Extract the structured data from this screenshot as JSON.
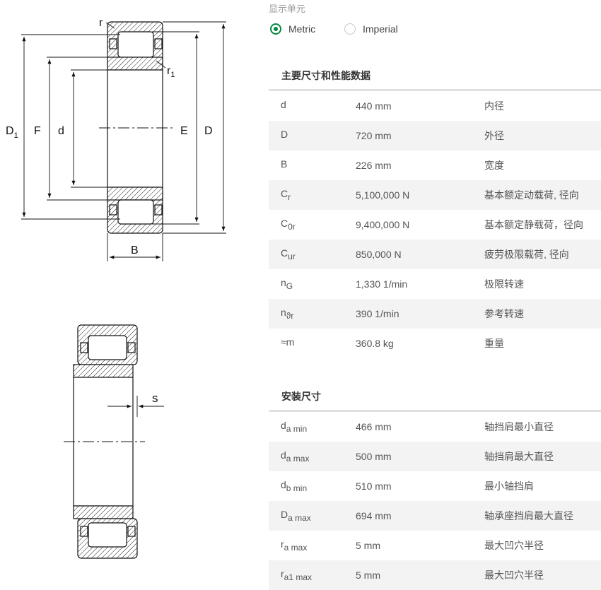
{
  "drawing_labels": {
    "r": "r",
    "r1_base": "r",
    "r1_sub": "1",
    "D1_base": "D",
    "D1_sub": "1",
    "F": "F",
    "d": "d",
    "E": "E",
    "D": "D",
    "B": "B",
    "s": "s"
  },
  "units": {
    "caption": "显示单元",
    "options": [
      {
        "label": "Metric",
        "selected": true
      },
      {
        "label": "Imperial",
        "selected": false
      }
    ]
  },
  "main_dimensions": {
    "title": "主要尺寸和性能数据",
    "rows": [
      {
        "sym": "d",
        "sub": "",
        "value": "440 mm",
        "desc": "内径"
      },
      {
        "sym": "D",
        "sub": "",
        "value": "720 mm",
        "desc": "外径"
      },
      {
        "sym": "B",
        "sub": "",
        "value": "226 mm",
        "desc": "宽度"
      },
      {
        "sym": "C",
        "sub": "r",
        "value": "5,100,000 N",
        "desc": "基本额定动载荷, 径向"
      },
      {
        "sym": "C",
        "sub": "0r",
        "value": "9,400,000 N",
        "desc": "基本额定静载荷，径向"
      },
      {
        "sym": "C",
        "sub": "ur",
        "value": "850,000 N",
        "desc": "疲劳极限载荷, 径向"
      },
      {
        "sym": "n",
        "sub": "G",
        "value": "1,330 1/min",
        "desc": "极限转速"
      },
      {
        "sym": "n",
        "sub": "ϑr",
        "value": "390 1/min",
        "desc": "参考转速"
      },
      {
        "sym": "≈m",
        "sub": "",
        "value": "360.8 kg",
        "desc": "重量"
      }
    ]
  },
  "mounting_dimensions": {
    "title": "安装尺寸",
    "rows": [
      {
        "sym": "d",
        "sub": "a min",
        "value": "466 mm",
        "desc": "轴挡肩最小直径"
      },
      {
        "sym": "d",
        "sub": "a max",
        "value": "500 mm",
        "desc": "轴挡肩最大直径"
      },
      {
        "sym": "d",
        "sub": "b min",
        "value": "510 mm",
        "desc": "最小轴挡肩"
      },
      {
        "sym": "D",
        "sub": "a max",
        "value": "694 mm",
        "desc": "轴承座挡肩最大直径"
      },
      {
        "sym": "r",
        "sub": "a max",
        "value": "5 mm",
        "desc": "最大凹穴半径"
      },
      {
        "sym": "r",
        "sub": "a1 max",
        "value": "5 mm",
        "desc": "最大凹穴半径"
      }
    ]
  }
}
